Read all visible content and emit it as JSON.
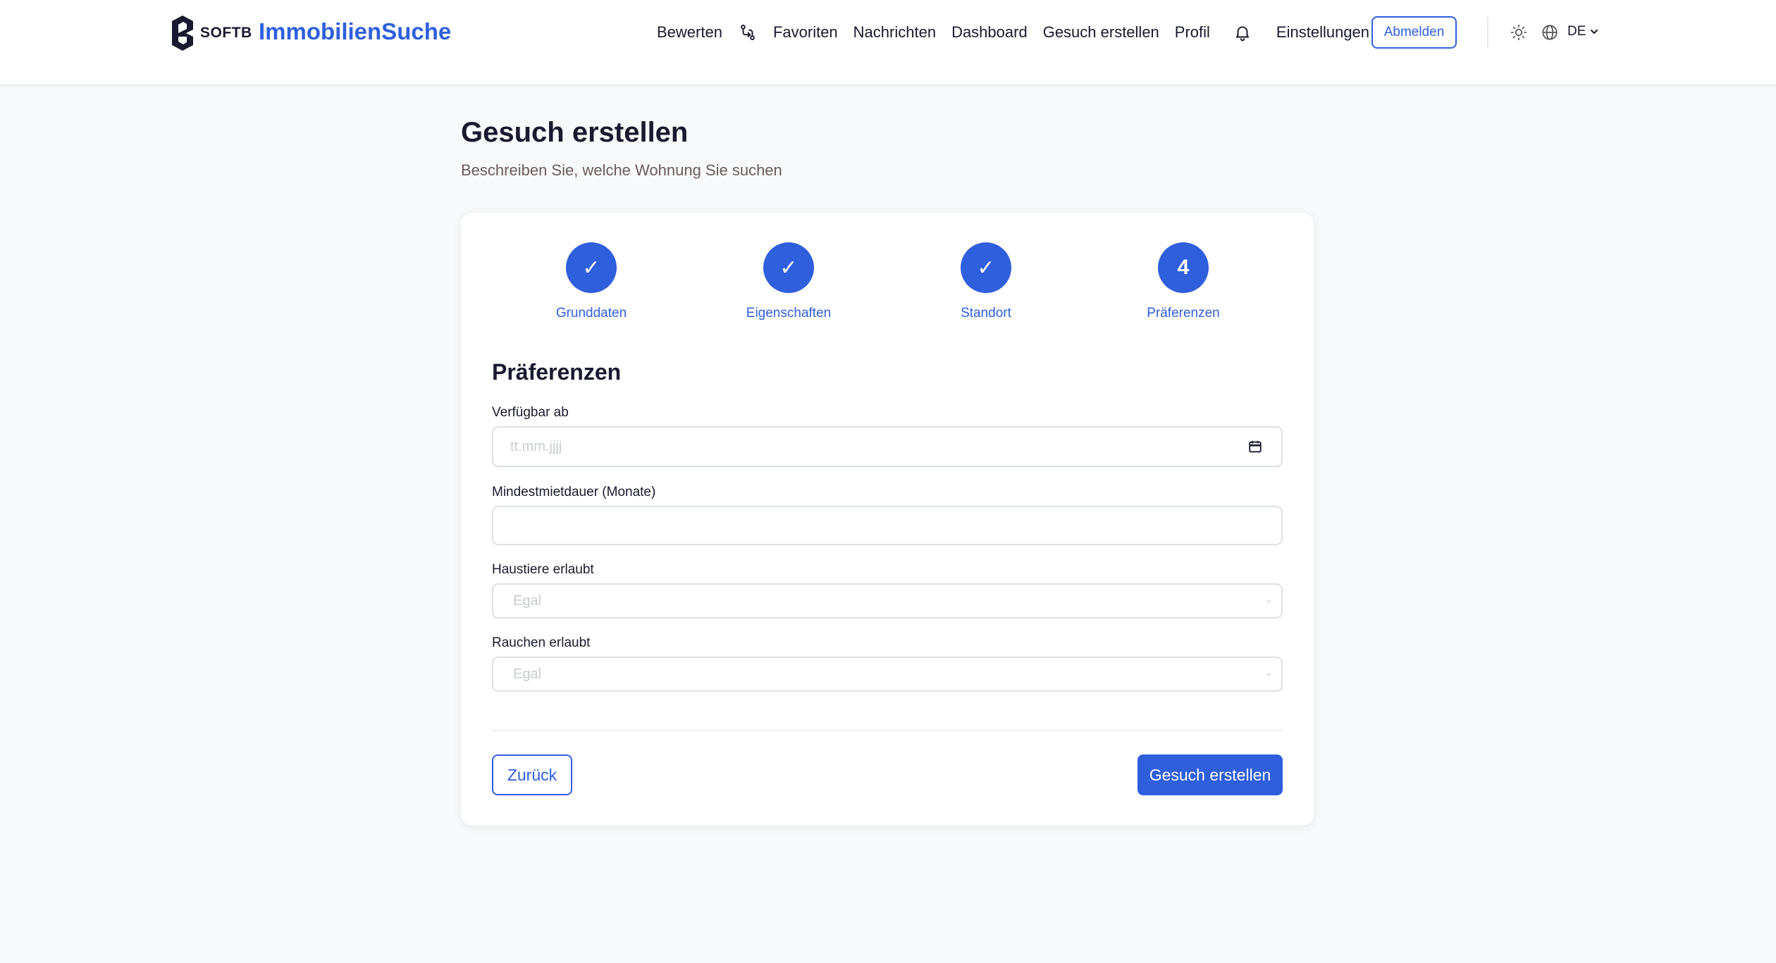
{
  "header": {
    "logo_text": "SOFTB",
    "brand": "ImmobilienSuche",
    "nav": {
      "rate": "Bewerten",
      "favorites": "Favoriten",
      "messages": "Nachrichten",
      "dashboard": "Dashboard",
      "create_request": "Gesuch erstellen",
      "profile": "Profil",
      "settings": "Einstellungen"
    },
    "logout": "Abmelden",
    "language": "DE"
  },
  "page": {
    "title": "Gesuch erstellen",
    "subtitle": "Beschreiben Sie, welche Wohnung Sie suchen"
  },
  "stepper": {
    "steps": [
      {
        "label": "Grunddaten",
        "marker": "✓"
      },
      {
        "label": "Eigenschaften",
        "marker": "✓"
      },
      {
        "label": "Standort",
        "marker": "✓"
      },
      {
        "label": "Präferenzen",
        "marker": "4"
      }
    ]
  },
  "form": {
    "section_title": "Präferenzen",
    "available_from": {
      "label": "Verfügbar ab",
      "placeholder": "tt.mm.jjjj"
    },
    "min_duration": {
      "label": "Mindestmietdauer (Monate)",
      "value": ""
    },
    "pets": {
      "label": "Haustiere erlaubt",
      "selected": "Egal"
    },
    "smoking": {
      "label": "Rauchen erlaubt",
      "selected": "Egal"
    },
    "back": "Zurück",
    "submit": "Gesuch erstellen"
  },
  "colors": {
    "accent": "#2f5fdc",
    "text": "#1a1a2e",
    "background": "#f8f9fa"
  }
}
